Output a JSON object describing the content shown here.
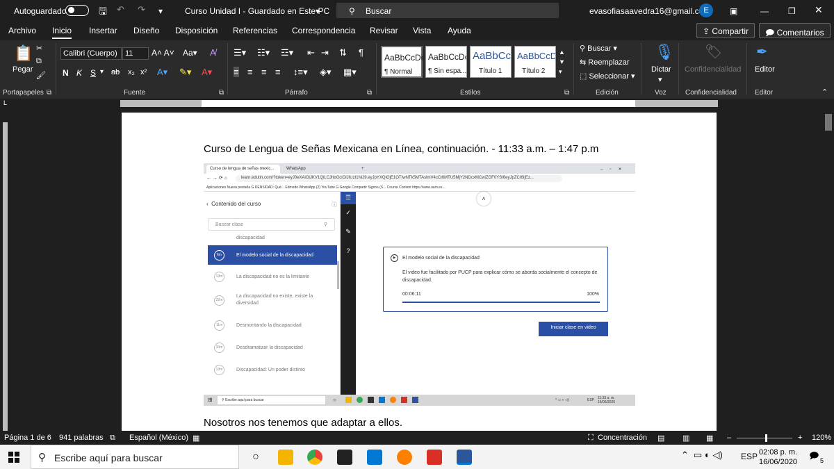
{
  "titlebar": {
    "autosave": "Autoguardado",
    "document": "Curso Unidad I  -  Guardado en Este PC",
    "search_placeholder": "Buscar",
    "email": "evasofiasaavedra16@gmail.com",
    "avatar": "E"
  },
  "menu": {
    "tabs": [
      "Archivo",
      "Inicio",
      "Insertar",
      "Diseño",
      "Disposición",
      "Referencias",
      "Correspondencia",
      "Revisar",
      "Vista",
      "Ayuda"
    ],
    "share": "Compartir",
    "comments": "Comentarios"
  },
  "ribbon": {
    "paste": "Pegar",
    "font_name": "Calibri (Cuerpo)",
    "font_size": "11",
    "styles": [
      {
        "preview": "AaBbCcDc",
        "name": "¶ Normal"
      },
      {
        "preview": "AaBbCcDc",
        "name": "¶ Sin espa..."
      },
      {
        "preview": "AaBbCc",
        "name": "Título 1"
      },
      {
        "preview": "AaBbCcD",
        "name": "Título 2"
      }
    ],
    "find": "Buscar",
    "replace": "Reemplazar",
    "select": "Seleccionar",
    "dictate": "Dictar",
    "sensitivity": "Confidencialidad",
    "editor": "Editor",
    "groups": {
      "clipboard": "Portapapeles",
      "font": "Fuente",
      "paragraph": "Párrafo",
      "styles": "Estilos",
      "editing": "Edición",
      "voice": "Voz",
      "sensitivity": "Confidencialidad",
      "editor": "Editor"
    }
  },
  "document": {
    "line1": "Curso de Lengua de Señas Mexicana en Línea, continuación.  - 11:33 a.m. – 1:47 p.m",
    "line2": "Nosotros nos tenemos que adaptar a ellos."
  },
  "screenshot": {
    "tab1": "Curso de lengua de señas mexic...",
    "tab2": "WhatsApp",
    "url": "learn.edutin.com/?token=eyJ0eXAiOiJKV1QiLCJhbGciOiJIUzI1NiJ9.eyJpYXQiOjE1OTIwNTk5MTAslmV4cCI6MTU5MjY2NDcxMCwiZGF0YSI6eyJpZCI6IjEz...",
    "bookmarks": "Aplicaciones   Nueva pestaña   G  DENSIDAD: Qué...   Edmodo   WhatsApp   (2) YouTube   G  Google   Compartir Signos (S...   Course Content   https://www.uam.es...",
    "content_header": "Contenido del curso",
    "search_class": "Buscar clase",
    "lessons": [
      {
        "dur": "",
        "title": "discapacidad"
      },
      {
        "dur": "6m",
        "title": "El modelo social de la discapacidad"
      },
      {
        "dur": "13m",
        "title": "La discapacidad no es la limitante"
      },
      {
        "dur": "22m",
        "title": "La discapacidad no existe, existe la diversidad"
      },
      {
        "dur": "11m",
        "title": "Desmontando la discapacidad"
      },
      {
        "dur": "10m",
        "title": "Desdramatizar la discapacidad"
      },
      {
        "dur": "13m",
        "title": "Discapacidad: Un poder distinto"
      }
    ],
    "card_title": "El modelo social de la discapacidad",
    "card_desc": "El video fue facilitado por PUCP para explicar cómo se aborda socialmente el concepto de discapacidad.",
    "card_time": "00:06:11",
    "card_progress": "100%",
    "start_button": "Iniciar clase en video",
    "taskbar_search": "Escribe aquí para buscar",
    "clock_time": "11:33 a. m.",
    "clock_date": "16/06/2020",
    "lang": "ESP"
  },
  "statusbar": {
    "page": "Página 1 de 6",
    "words": "941 palabras",
    "language": "Español (México)",
    "focus": "Concentración",
    "zoom": "120%"
  },
  "taskbar": {
    "search": "Escribe aquí para buscar",
    "lang": "ESP",
    "time": "02:08 p. m.",
    "date": "16/06/2020",
    "notifications": "5"
  },
  "colors": {
    "accent_blue": "#2b4fa4",
    "word_blue": "#2f5597",
    "dark_ui": "#1f1f1f"
  }
}
